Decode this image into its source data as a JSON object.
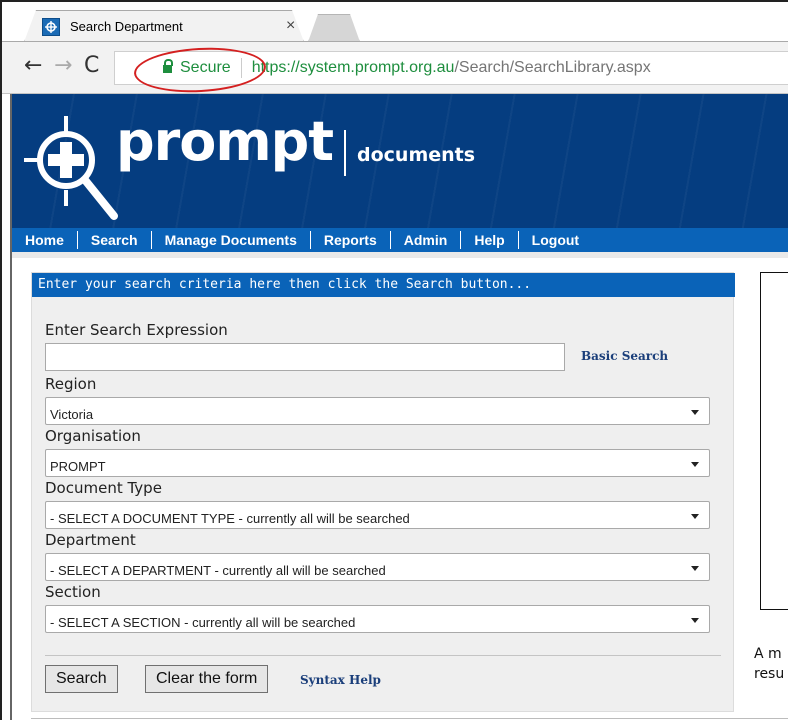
{
  "browser": {
    "tab_title": "Search Department",
    "tab_close": "×",
    "secure_label": "Secure",
    "url_host": "https://system.prompt.org.au",
    "url_path": "/Search/SearchLibrary.aspx",
    "back_glyph": "←",
    "forward_glyph": "→",
    "reload_glyph": "C",
    "highlight_color": "#d42020"
  },
  "banner": {
    "logo_text": "prompt",
    "logo_subtitle": "documents",
    "brand_color": "#053d80"
  },
  "nav": {
    "items": [
      "Home",
      "Search",
      "Manage Documents",
      "Reports",
      "Admin",
      "Help",
      "Logout"
    ],
    "color": "#0a63b8"
  },
  "panel": {
    "header": "Enter your search criteria here then click the Search button...",
    "expression_label": "Enter Search Expression",
    "expression_value": "",
    "basic_search_link": "Basic Search",
    "region_label": "Region",
    "region_value": "Victoria",
    "organisation_label": "Organisation",
    "organisation_value": "PROMPT",
    "doctype_label": "Document Type",
    "doctype_value": "- SELECT A DOCUMENT TYPE - currently all will be searched",
    "department_label": "Department",
    "department_value": "- SELECT A DEPARTMENT - currently all will be searched",
    "section_label": "Section",
    "section_value": "- SELECT A SECTION - currently all will be searched",
    "search_button": "Search",
    "clear_button": "Clear the form",
    "syntax_help_link": "Syntax Help"
  },
  "right_panel": {
    "text": "A m\nresu"
  }
}
